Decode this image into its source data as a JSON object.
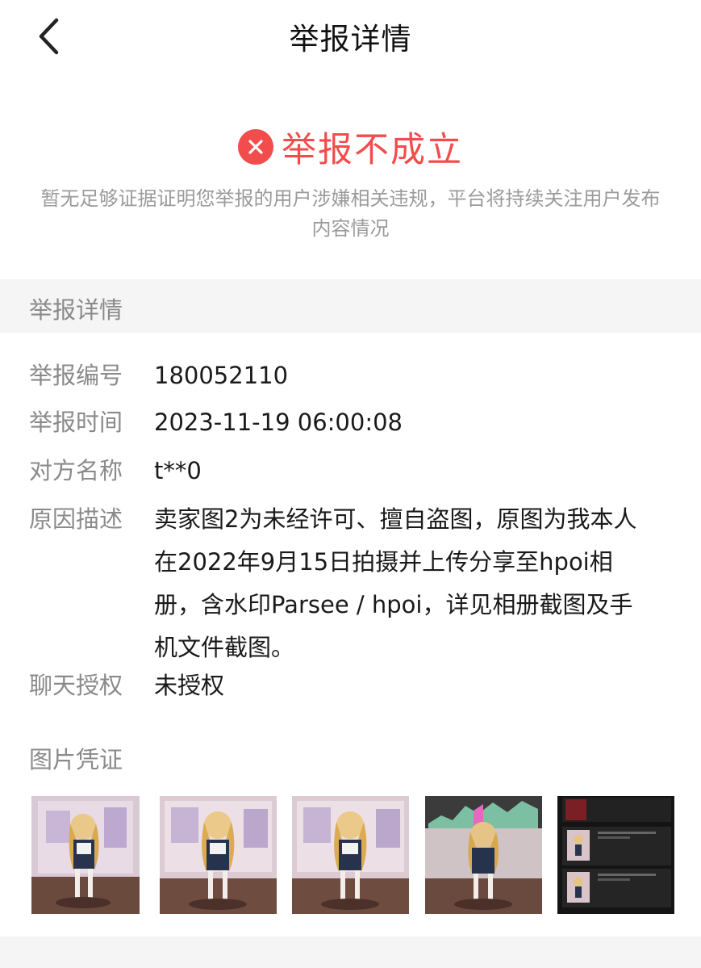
{
  "nav": {
    "title": "举报详情",
    "back_icon": "chevron-left-icon"
  },
  "result": {
    "status": "举报不成立",
    "status_color": "#f24c4c",
    "icon": "close-circle-icon",
    "description": "暂无足够证据证明您举报的用户涉嫌相关违规，平台将持续关注用户发布内容情况"
  },
  "section": {
    "title": "举报详情"
  },
  "details": {
    "report_no_label": "举报编号",
    "report_no": "180052110",
    "report_time_label": "举报时间",
    "report_time": "2023-11-19 06:00:08",
    "target_label": "对方名称",
    "target": "t**0",
    "reason_label": "原因描述",
    "reason": "卖家图2为未经许可、擅自盗图，原图为我本人在2022年9月15日拍摄并上传分享至hpoi相册，含水印Parsee / hpoi，详见相册截图及手机文件截图。",
    "chat_label": "聊天授权",
    "chat": "未授权"
  },
  "proof": {
    "label": "图片凭证",
    "images": [
      "figure-photo-1",
      "figure-photo-2",
      "figure-photo-3",
      "figure-photo-4",
      "screenshot-5"
    ]
  }
}
